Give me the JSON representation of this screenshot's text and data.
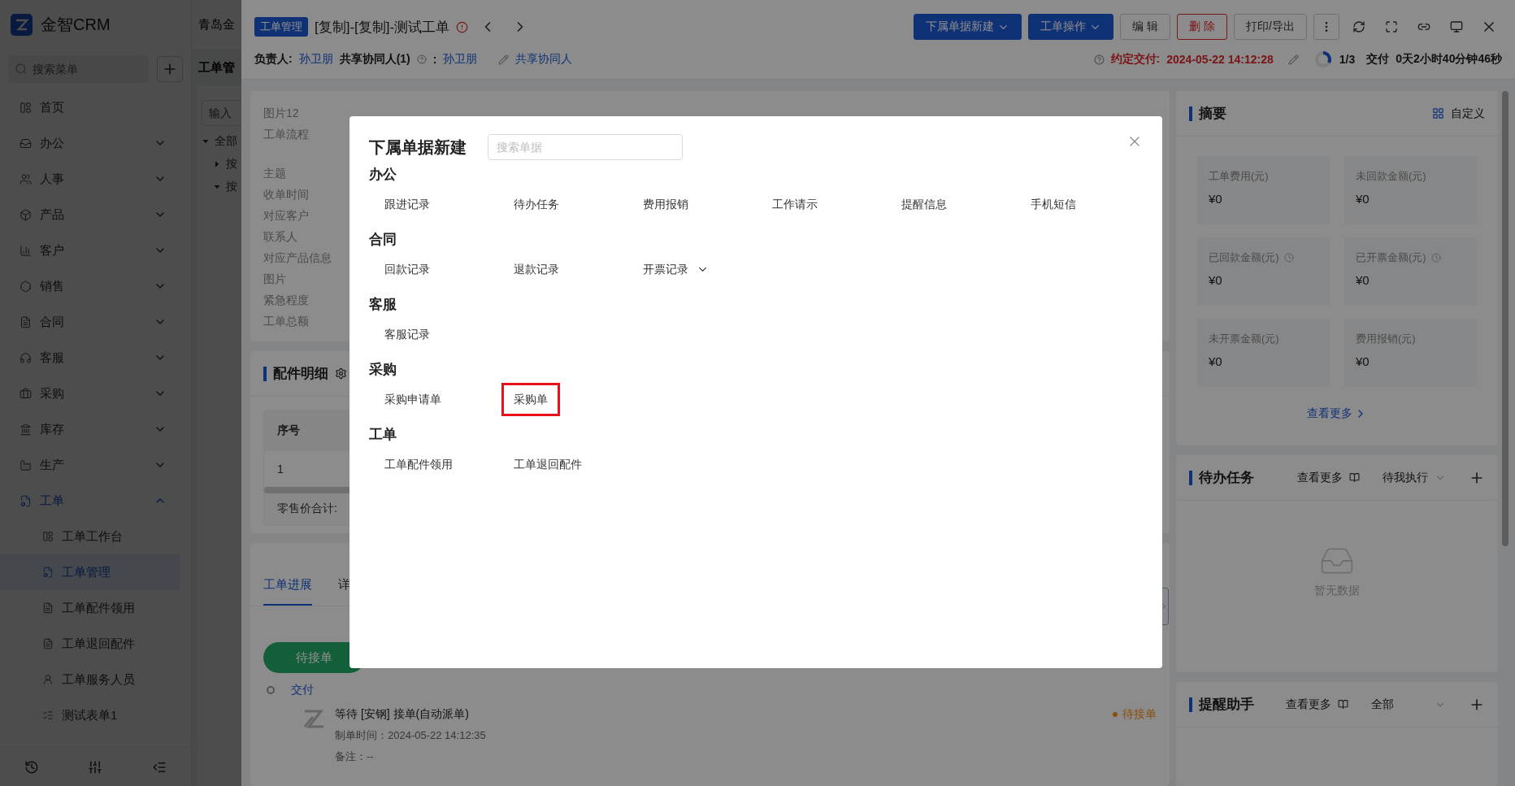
{
  "sidebar": {
    "logo": "金智CRM",
    "search_placeholder": "搜索菜单",
    "items": [
      {
        "label": "首页",
        "kind": "link"
      },
      {
        "label": "办公",
        "kind": "group",
        "expanded": false
      },
      {
        "label": "人事",
        "kind": "group",
        "expanded": false
      },
      {
        "label": "产品",
        "kind": "group",
        "expanded": false
      },
      {
        "label": "客户",
        "kind": "group",
        "expanded": false
      },
      {
        "label": "销售",
        "kind": "group",
        "expanded": false
      },
      {
        "label": "合同",
        "kind": "group",
        "expanded": false
      },
      {
        "label": "客服",
        "kind": "group",
        "expanded": false
      },
      {
        "label": "采购",
        "kind": "group",
        "expanded": false
      },
      {
        "label": "库存",
        "kind": "group",
        "expanded": false
      },
      {
        "label": "生产",
        "kind": "group",
        "expanded": false
      },
      {
        "label": "工单",
        "kind": "group",
        "expanded": true,
        "children": [
          {
            "label": "工单工作台",
            "selected": false
          },
          {
            "label": "工单管理",
            "selected": true
          },
          {
            "label": "工单配件领用",
            "selected": false
          },
          {
            "label": "工单退回配件",
            "selected": false
          },
          {
            "label": "工单服务人员",
            "selected": false
          },
          {
            "label": "测试表单1",
            "selected": false
          }
        ]
      }
    ]
  },
  "main": {
    "company": "青岛金",
    "page_title": "工单管",
    "filter_placeholder": "输入",
    "tree": [
      {
        "label": "全部",
        "expanded": true,
        "children": [
          {
            "label": "按",
            "expanded": false
          },
          {
            "label": "按",
            "expanded": true
          }
        ]
      }
    ]
  },
  "drawer": {
    "tag": "工单管理",
    "title": "[复制]-[复制]-测试工单",
    "buttons": [
      {
        "label": "下属单据新建",
        "kind": "primary"
      },
      {
        "label": "工单操作",
        "kind": "primary"
      },
      {
        "label": "编 辑",
        "kind": "default"
      },
      {
        "label": "删 除",
        "kind": "danger"
      },
      {
        "label": "打印/导出",
        "kind": "default"
      }
    ],
    "owner_label": "负责人:",
    "owner": "孙卫朋",
    "collab_label": "共享协同人(1)",
    "collab_colon": ":",
    "collab": "孙卫朋",
    "share_link": "共享协同人",
    "due_label": "约定交付:",
    "due": "2024-05-22 14:12:28",
    "progress": {
      "text": "1/3",
      "level": 0.33
    },
    "stage": "交付",
    "elapsed": "0天2小时40分钟46秒",
    "detail_sections": [
      {
        "labels": [
          "图片12",
          "工单流程"
        ]
      },
      {
        "labels": [
          "主题",
          "收单时间",
          "对应客户",
          "联系人",
          "对应产品信息",
          "图片",
          "紧急程度",
          "工单总额"
        ]
      }
    ],
    "parts": {
      "title": "配件明细",
      "columns": [
        "序号"
      ],
      "rows": [
        [
          "1"
        ]
      ],
      "total_label": "零售价合计:"
    },
    "progress_card": {
      "tabs": [
        {
          "label": "工单进展",
          "selected": true
        },
        {
          "label": "详",
          "selected": false
        }
      ],
      "steps": [
        {
          "label": "待接单",
          "kind": "current"
        }
      ],
      "timeline": [
        {
          "stage": "交付",
          "title": "等待 [安钢] 接单(自动派单)",
          "time": "制单时间：2024-05-22 14:12:35",
          "note": "备注：--",
          "status": "待接单"
        }
      ]
    },
    "summary": {
      "title": "摘要",
      "customize": "自定义",
      "more": "查看更多",
      "stats": [
        {
          "label": "工单费用(元)",
          "value": "¥0",
          "timed": false
        },
        {
          "label": "未回款金额(元)",
          "value": "¥0",
          "timed": false
        },
        {
          "label": "已回款金额(元)",
          "value": "¥0",
          "timed": true
        },
        {
          "label": "已开票金额(元)",
          "value": "¥0",
          "timed": true
        },
        {
          "label": "未开票金额(元)",
          "value": "¥0",
          "timed": false
        },
        {
          "label": "费用报销(元)",
          "value": "¥0",
          "timed": false
        }
      ]
    },
    "todo": {
      "title": "待办任务",
      "more": "查看更多",
      "filter": "待我执行",
      "empty": "暂无数据"
    },
    "reminder": {
      "title": "提醒助手",
      "more": "查看更多",
      "filter": "全部"
    }
  },
  "modal": {
    "title": "下属单据新建",
    "search_placeholder": "搜索单据",
    "groups": [
      {
        "title": "办公",
        "items": [
          {
            "label": "跟进记录",
            "kind": "plain",
            "highlighted": false
          },
          {
            "label": "待办任务",
            "kind": "plain",
            "highlighted": false
          },
          {
            "label": "费用报销",
            "kind": "plain",
            "highlighted": false
          },
          {
            "label": "工作请示",
            "kind": "plain",
            "highlighted": false
          },
          {
            "label": "提醒信息",
            "kind": "plain",
            "highlighted": false
          },
          {
            "label": "手机短信",
            "kind": "plain",
            "highlighted": false
          }
        ]
      },
      {
        "title": "合同",
        "items": [
          {
            "label": "回款记录",
            "kind": "plain",
            "highlighted": false
          },
          {
            "label": "退款记录",
            "kind": "plain",
            "highlighted": false
          },
          {
            "label": "开票记录",
            "kind": "dropdown",
            "highlighted": false
          }
        ]
      },
      {
        "title": "客服",
        "items": [
          {
            "label": "客服记录",
            "kind": "plain",
            "highlighted": false
          }
        ]
      },
      {
        "title": "采购",
        "items": [
          {
            "label": "采购申请单",
            "kind": "plain",
            "highlighted": false
          },
          {
            "label": "采购单",
            "kind": "plain",
            "highlighted": true
          }
        ]
      },
      {
        "title": "工单",
        "items": [
          {
            "label": "工单配件领用",
            "kind": "plain",
            "highlighted": false
          },
          {
            "label": "工单退回配件",
            "kind": "plain",
            "highlighted": false
          }
        ]
      }
    ]
  }
}
